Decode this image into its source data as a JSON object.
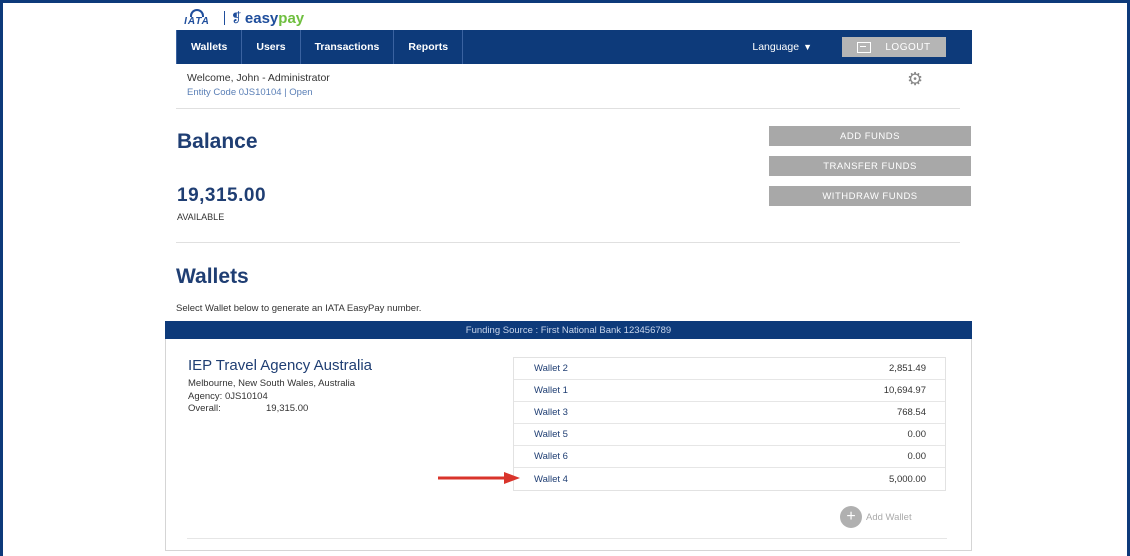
{
  "brand": {
    "iata": "IATA",
    "easy": "easy",
    "pay": "pay"
  },
  "nav": {
    "items": [
      "Wallets",
      "Users",
      "Transactions",
      "Reports"
    ],
    "language": "Language",
    "logout": "LOGOUT"
  },
  "welcome": {
    "name": "Welcome, John - Administrator",
    "entity": "Entity Code 0JS10104 | Open"
  },
  "balance": {
    "title": "Balance",
    "amount": "19,315.00",
    "label": "AVAILABLE",
    "buttons": [
      "ADD FUNDS",
      "TRANSFER FUNDS",
      "WITHDRAW FUNDS"
    ]
  },
  "wallets": {
    "title": "Wallets",
    "subtitle": "Select Wallet below to generate an IATA EasyPay number.",
    "funding_source": "Funding Source : First National Bank 123456789",
    "agency": {
      "name": "IEP Travel Agency Australia",
      "location": "Melbourne, New South Wales, Australia",
      "code": "Agency: 0JS10104",
      "overall_label": "Overall:",
      "overall_value": "19,315.00"
    },
    "rows": [
      {
        "name": "Wallet 2",
        "amount": "2,851.49"
      },
      {
        "name": "Wallet 1",
        "amount": "10,694.97"
      },
      {
        "name": "Wallet 3",
        "amount": "768.54"
      },
      {
        "name": "Wallet 5",
        "amount": "0.00"
      },
      {
        "name": "Wallet 6",
        "amount": "0.00"
      },
      {
        "name": "Wallet 4",
        "amount": "5,000.00"
      }
    ],
    "add_wallet": "Add Wallet"
  },
  "colors": {
    "navy": "#0d3a7a",
    "heading": "#1f3e73",
    "button_gray": "#a8a8a8",
    "arrow_red": "#d9342b",
    "easypay_green": "#6fbf3f"
  }
}
